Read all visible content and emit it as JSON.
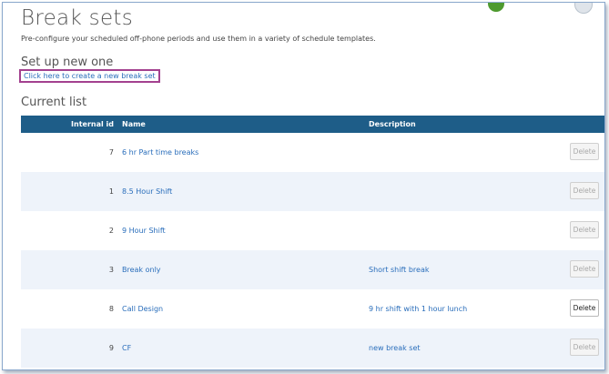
{
  "header": {
    "title": "Break sets",
    "subtitle": "Pre-configure your scheduled off-phone periods and use them in a variety of schedule templates."
  },
  "setup": {
    "title": "Set up new one",
    "create_link": "Click here to create a new break set"
  },
  "current": {
    "title": "Current list"
  },
  "table": {
    "columns": [
      "Internal id",
      "Name",
      "Description"
    ],
    "delete_label": "Delete",
    "rows": [
      {
        "id": "7",
        "name": "6 hr Part time breaks",
        "description": "",
        "delete_enabled": false
      },
      {
        "id": "1",
        "name": "8.5 Hour Shift",
        "description": "",
        "delete_enabled": false
      },
      {
        "id": "2",
        "name": "9 Hour Shift",
        "description": "",
        "delete_enabled": false
      },
      {
        "id": "3",
        "name": "Break only",
        "description": "Short shift break",
        "delete_enabled": false
      },
      {
        "id": "8",
        "name": "Call Design",
        "description": "9 hr shift with 1 hour lunch",
        "delete_enabled": true
      },
      {
        "id": "9",
        "name": "CF",
        "description": "new break set",
        "delete_enabled": false
      }
    ]
  },
  "colors": {
    "header_bg": "#1e5d88",
    "link": "#2a6ebb",
    "highlight_border": "#a3418f",
    "row_alt": "#eef3fa",
    "avatar_green": "#4e9a2f"
  }
}
